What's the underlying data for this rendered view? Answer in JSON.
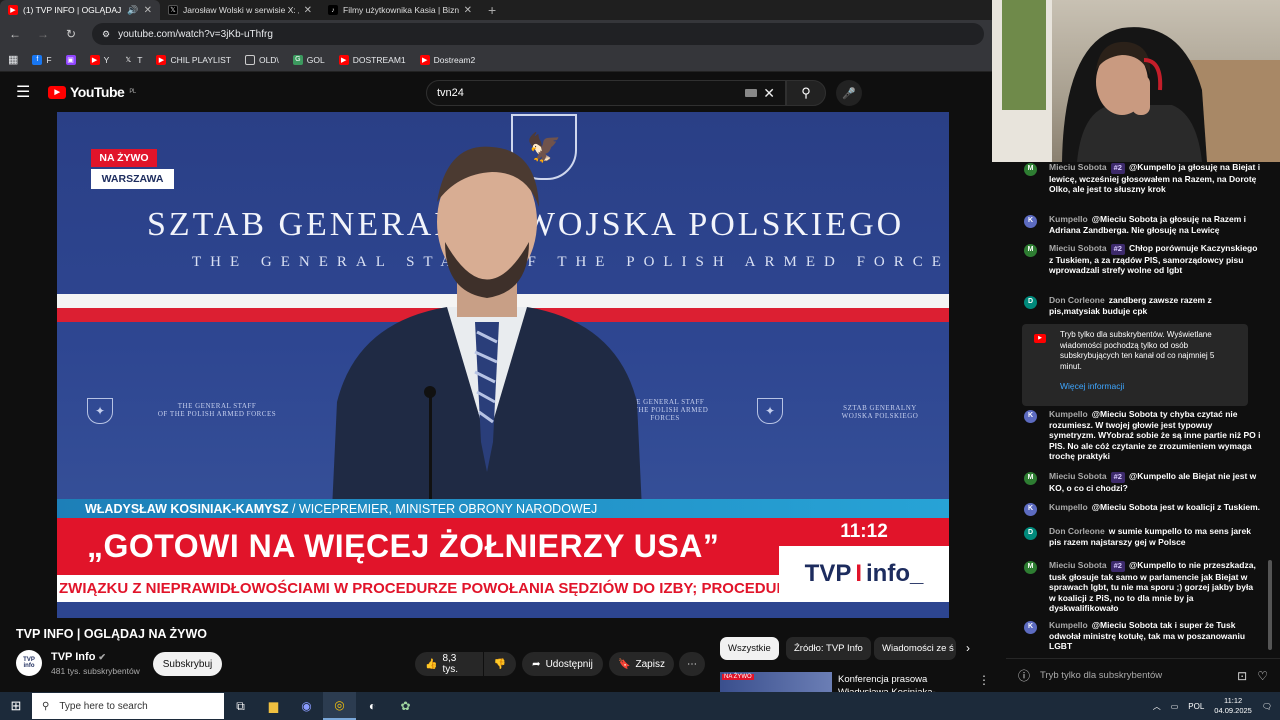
{
  "browser": {
    "tabs": [
      {
        "title": "(1) TVP INFO | OGLĄDAJ N",
        "active": true,
        "favicon": "youtube-icon",
        "color": "#ff0000"
      },
      {
        "title": "Jarosław Wolski w serwisie X: „I",
        "active": false,
        "favicon": "x-icon",
        "color": "#000000"
      },
      {
        "title": "Filmy użytkownika Kasia | Bizne",
        "active": false,
        "favicon": "tiktok-icon",
        "color": "#000000"
      }
    ],
    "url": "youtube.com/watch?v=3jKb-uThfrg",
    "bookmarks": [
      {
        "label": "F",
        "icon": "facebook-icon",
        "color": "#1877f2"
      },
      {
        "label": "",
        "icon": "twitch-icon",
        "color": "#9146ff"
      },
      {
        "label": "Y",
        "icon": "youtube-icon",
        "color": "#ff0000"
      },
      {
        "label": "T",
        "icon": "x-icon",
        "color": "#000000"
      },
      {
        "label": "CHIL PLAYLIST",
        "icon": "youtube-icon",
        "color": "#ff0000"
      },
      {
        "label": "OLD\\",
        "icon": "folder-icon",
        "color": "#35363a"
      },
      {
        "label": "GOL",
        "icon": "gol-icon",
        "color": "#3c9a5f"
      },
      {
        "label": "DOSTREAM1",
        "icon": "youtube-icon",
        "color": "#ff0000"
      },
      {
        "label": "Dostream2",
        "icon": "youtube-icon",
        "color": "#ff0000"
      }
    ]
  },
  "youtube": {
    "logo_text": "YouTube",
    "logo_region": "PL",
    "search_value": "tvn24"
  },
  "video": {
    "live_label": "NA ŻYWO",
    "city": "WARSZAWA",
    "wall_title": "SZTAB GENERALNY WOJSKA POLSKIEGO",
    "wall_subtitle": "THE GENERAL STAFF OF THE POLISH ARMED FORCES",
    "panel_left": "THE GENERAL STAFF\nOF THE POLISH ARMED FORCES",
    "panel_right": "SZTAB GENERALNY\nWOJSKA POLSKIEGO",
    "panel_mid": "THE GENERAL STAFF\nOF THE POLISH ARMED FORCES",
    "speaker_name": "WŁADYSŁAW KOSINIAK-KAMYSZ",
    "speaker_role": "/ WICEPREMIER, MINISTER OBRONY NARODOWEJ",
    "headline": "„GOTOWI NA WIĘCEJ ŻOŁNIERZY USA”",
    "clock": "11:12",
    "channel_logo_a": "TVP",
    "channel_logo_sep": "I",
    "channel_logo_b": "info_",
    "ticker": "ZWIĄZKU Z NIEPRAWIDŁOWOŚCIAMI W PROCEDURZE POWOŁANIA SĘDZIÓW DO IZBY; PROCEDURA TA BYŁA"
  },
  "below_video": {
    "title": "TVP INFO | OGLĄDAJ NA ŻYWO",
    "channel_name": "TVP Info",
    "channel_avatar": "TVP\ninfo",
    "subscribers": "481 tys. subskrybentów",
    "subscribe_label": "Subskrybuj",
    "likes": "8,3 tys.",
    "share_label": "Udostępnij",
    "save_label": "Zapisz"
  },
  "related": {
    "chips": [
      "Wszystkie",
      "Źródło: TVP Info",
      "Wiadomości ze ś"
    ],
    "first_title": "Konferencja prasowa Władysława Kosiniaka-",
    "first_thumb_tag": "NA ŻYWO"
  },
  "chat": {
    "messages": [
      {
        "initial": "M",
        "color": "#2e7d32",
        "author": "Mieciu Sobota",
        "badge": "#2",
        "text": "@Kumpello ja głosuję na Biejat i lewicę, wcześniej głosowałem na Razem, na Dorotę Olko, ale jest to słuszny krok"
      },
      {
        "initial": "K",
        "color": "#5c6bc0",
        "author": "Kumpello",
        "badge": "",
        "text": "@Mieciu Sobota ja głosuję na Razem i Adriana Zandberga. Nie głosuję na Lewicę"
      },
      {
        "initial": "M",
        "color": "#2e7d32",
        "author": "Mieciu Sobota",
        "badge": "#2",
        "text": "Chłop porównuje Kaczynskiego z Tuskiem, a za rządów PIS, samorządowcy pisu wprowadzali strefy wolne od lgbt"
      },
      {
        "initial": "D",
        "color": "#00897b",
        "author": "Don Corleone",
        "badge": "",
        "text": "zandberg zawsze razem z pis,matysiak buduje cpk"
      },
      {
        "initial": "K",
        "color": "#5c6bc0",
        "author": "Kumpello",
        "badge": "",
        "text": "@Mieciu Sobota ty chyba czytać nie rozumiesz. W twojej głowie jest typowuy symetryzm. WYobraź sobie że są inne partie niż PO i PIS. No ale cóż czytanie ze zrozumieniem wymaga trochę praktyki"
      },
      {
        "initial": "M",
        "color": "#2e7d32",
        "author": "Mieciu Sobota",
        "badge": "#2",
        "text": "@Kumpello ale Biejat nie jest w KO, o co ci chodzi?"
      },
      {
        "initial": "K",
        "color": "#5c6bc0",
        "author": "Kumpello",
        "badge": "",
        "text": "@Mieciu Sobota jest w koalicji z Tuskiem."
      },
      {
        "initial": "D",
        "color": "#00897b",
        "author": "Don Corleone",
        "badge": "",
        "text": "w sumie kumpello to ma sens jarek pis razem najstarszy gej w Polsce"
      },
      {
        "initial": "M",
        "color": "#2e7d32",
        "author": "Mieciu Sobota",
        "badge": "#2",
        "text": "@Kumpello to nie przeszkadza, tusk głosuje tak samo w parlamencie jak Biejat w sprawach lgbt, tu nie ma sporu ;) gorzej jakby była w koalicji z PiS, no to dla mnie by ja dyskwalifikowało"
      },
      {
        "initial": "K",
        "color": "#5c6bc0",
        "author": "Kumpello",
        "badge": "",
        "text": "@Mieciu Sobota tak i super że Tusk odwołał ministrę kotułę, tak ma w poszanowaniu LGBT"
      }
    ],
    "system_text": "Tryb tylko dla subskrybentów. Wyświetlane wiadomości pochodzą tylko od osób subskrybujących ten kanał od co najmniej 5 minut.",
    "system_link": "Więcej informacji",
    "input_placeholder": "Tryb tylko dla subskrybentów"
  },
  "taskbar": {
    "search_placeholder": "Type here to search",
    "lang": "POL",
    "time": "11:12",
    "date": "04.09.2025"
  }
}
